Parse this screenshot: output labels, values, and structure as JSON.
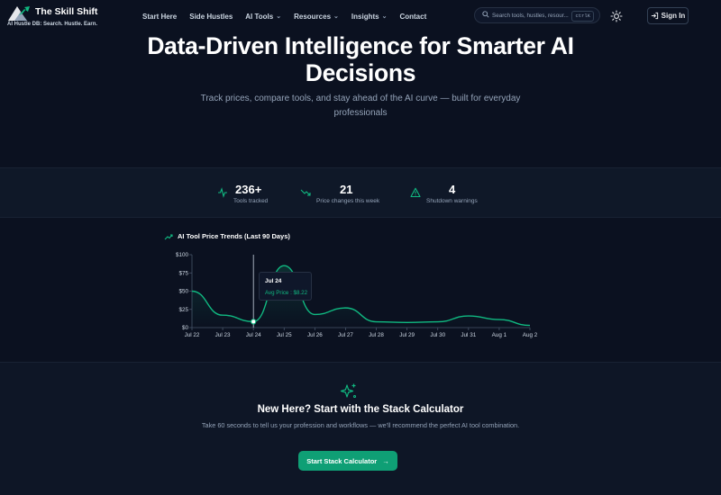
{
  "brand": {
    "name": "The Skill Shift",
    "tagline": "AI Hustle DB: Search. Hustle. Earn."
  },
  "nav": {
    "items": [
      {
        "label": "Start Here",
        "dropdown": false
      },
      {
        "label": "Side Hustles",
        "dropdown": false
      },
      {
        "label": "AI Tools",
        "dropdown": true
      },
      {
        "label": "Resources",
        "dropdown": true
      },
      {
        "label": "Insights",
        "dropdown": true
      },
      {
        "label": "Contact",
        "dropdown": false
      }
    ],
    "search_placeholder": "Search tools, hustles, resour...",
    "search_shortcut": "ctrlK",
    "signin_label": "Sign In"
  },
  "hero": {
    "title": "Data-Driven Intelligence for Smarter AI Decisions",
    "subtitle": "Track prices, compare tools, and stay ahead of the AI curve — built for everyday professionals"
  },
  "stats": [
    {
      "value": "236+",
      "label": "Tools tracked",
      "icon": "activity-icon"
    },
    {
      "value": "21",
      "label": "Price changes this week",
      "icon": "trending-down-icon"
    },
    {
      "value": "4",
      "label": "Shutdown warnings",
      "icon": "warning-icon"
    }
  ],
  "chart_data": {
    "type": "area",
    "title": "AI Tool Price Trends (Last 90 Days)",
    "x": [
      "Jul 22",
      "Jul 23",
      "Jul 24",
      "Jul 25",
      "Jul 26",
      "Jul 27",
      "Jul 28",
      "Jul 29",
      "Jul 30",
      "Jul 31",
      "Aug 1",
      "Aug 2"
    ],
    "series": [
      {
        "values": [
          50,
          17,
          8.22,
          85,
          18,
          27,
          8,
          7,
          8,
          16,
          11,
          3
        ]
      }
    ],
    "y_ticks": [
      "$0",
      "$25",
      "$50",
      "$75",
      "$100"
    ],
    "ylim": [
      0,
      100
    ],
    "series_color": "#10b981",
    "tooltip": {
      "date": "Jul 24",
      "label": "Avg Price",
      "value": "$8.22"
    }
  },
  "cta": {
    "title": "New Here? Start with the Stack Calculator",
    "subtitle": "Take 60 seconds to tell us your profession and workflows — we'll recommend the perfect AI tool combination.",
    "button_label": "Start Stack Calculator"
  }
}
